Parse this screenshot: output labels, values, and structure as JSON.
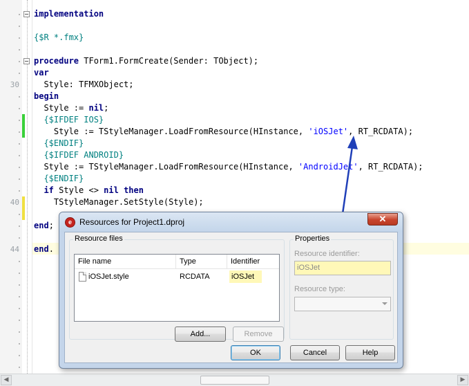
{
  "editor": {
    "line_numbers": [
      "30",
      "40",
      "44"
    ],
    "lines": [
      {
        "t": [
          {
            "s": "implementation",
            "c": "kw"
          }
        ]
      },
      {
        "t": []
      },
      {
        "t": [
          {
            "s": "{$R *.fmx}",
            "c": "dir"
          }
        ]
      },
      {
        "t": []
      },
      {
        "t": [
          {
            "s": "procedure",
            "c": "kw"
          },
          {
            "s": " TForm1.FormCreate(Sender: TObject);",
            "c": ""
          }
        ]
      },
      {
        "t": [
          {
            "s": "var",
            "c": "kw"
          }
        ]
      },
      {
        "t": [
          {
            "s": "  Style: TFMXObject;",
            "c": ""
          }
        ]
      },
      {
        "t": [
          {
            "s": "begin",
            "c": "kw"
          }
        ]
      },
      {
        "t": [
          {
            "s": "  Style := ",
            "c": ""
          },
          {
            "s": "nil",
            "c": "kw"
          },
          {
            "s": ";",
            "c": ""
          }
        ]
      },
      {
        "t": [
          {
            "s": "  {$IFDEF IOS}",
            "c": "dir"
          }
        ]
      },
      {
        "t": [
          {
            "s": "    Style := TStyleManager.LoadFromResource(HInstance, ",
            "c": ""
          },
          {
            "s": "'iOSJet'",
            "c": "str"
          },
          {
            "s": ", RT_RCDATA);",
            "c": ""
          }
        ]
      },
      {
        "t": [
          {
            "s": "  {$ENDIF}",
            "c": "dir"
          }
        ]
      },
      {
        "t": [
          {
            "s": "  {$IFDEF ANDROID}",
            "c": "dir"
          }
        ]
      },
      {
        "t": [
          {
            "s": "  Style := TStyleManager.LoadFromResource(HInstance, ",
            "c": ""
          },
          {
            "s": "'AndroidJet'",
            "c": "str"
          },
          {
            "s": ", RT_RCDATA);",
            "c": ""
          }
        ]
      },
      {
        "t": [
          {
            "s": "  {$ENDIF}",
            "c": "dir"
          }
        ]
      },
      {
        "t": [
          {
            "s": "  ",
            "c": ""
          },
          {
            "s": "if",
            "c": "kw"
          },
          {
            "s": " Style <> ",
            "c": ""
          },
          {
            "s": "nil",
            "c": "kw"
          },
          {
            "s": " ",
            "c": ""
          },
          {
            "s": "then",
            "c": "kw"
          }
        ]
      },
      {
        "t": [
          {
            "s": "    TStyleManager.SetStyle(Style);",
            "c": ""
          }
        ]
      },
      {
        "t": []
      },
      {
        "t": [
          {
            "s": "end",
            "c": "kw"
          },
          {
            "s": ";",
            "c": ""
          }
        ]
      },
      {
        "t": []
      },
      {
        "t": [
          {
            "s": "end",
            "c": "kw"
          },
          {
            "s": ".",
            "c": ""
          }
        ]
      }
    ]
  },
  "dialog": {
    "title": "Resources for Project1.dproj",
    "close_symbol": "✕",
    "app_icon_glyph": "e",
    "resource_files_label": "Resource files",
    "columns": [
      "File name",
      "Type",
      "Identifier"
    ],
    "rows": [
      {
        "file": "iOSJet.style",
        "type": "RCDATA",
        "identifier": "iOSJet"
      }
    ],
    "add_button": "Add...",
    "remove_button": "Remove",
    "properties_label": "Properties",
    "resource_identifier_label": "Resource identifier:",
    "resource_identifier_value": "iOSJet",
    "resource_type_label": "Resource type:",
    "resource_type_value": "",
    "ok_button": "OK",
    "cancel_button": "Cancel",
    "help_button": "Help"
  },
  "colors": {
    "keyword": "#000080",
    "directive": "#008080",
    "string": "#0000ff",
    "identifier_highlight": "#fff8b8",
    "annotation_arrow": "#1f3fb8",
    "change_marker_green": "#39d139",
    "change_marker_yellow": "#f0e040"
  },
  "icons": {
    "scroll_left": "◀",
    "scroll_right": "▶"
  }
}
